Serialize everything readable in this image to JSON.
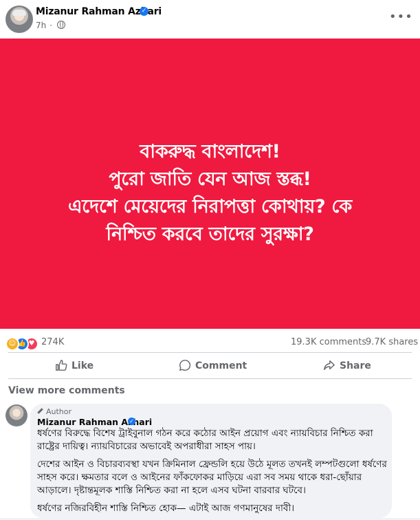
{
  "post": {
    "author": "Mizanur Rahman Azhari",
    "time": "7h",
    "separator": "·",
    "menu_label": "•••"
  },
  "poster": {
    "background": "#f0193f",
    "lines": [
      "বাকরুদ্ধ বাংলাদেশ!",
      "পুরো জাতি যেন আজ স্তব্ধ!",
      "এদেশে মেয়েদের নিরাপত্তা কোথায়? কে",
      "নিশ্চিত করবে তাদের সুরক্ষা?"
    ]
  },
  "stats": {
    "reactions": "274K",
    "comments": "19.3K comments",
    "shares": "9.7K shares",
    "reaction_icons": [
      "care-icon",
      "like-icon",
      "love-icon"
    ]
  },
  "actions": {
    "like": "Like",
    "comment": "Comment",
    "share": "Share"
  },
  "comments": {
    "view_more": "View more comments",
    "top": {
      "badge": "Author",
      "author": "Mizanur Rahman Azhari",
      "paragraphs": [
        "ধর্ষণের বিরুদ্ধে বিশেষ ট্রাইবুনাল গঠন করে কঠোর আইন প্রয়োগ এবং ন্যায়বিচার নিশ্চিত করা রাষ্ট্রের দায়িত্ব। ন্যায়বিচারের অভাবেই অপরাধীরা সাহস পায়।",
        "দেশের আইন ও বিচারব্যবস্থা যখন ক্রিমিনাল ফ্রেন্ডলি হয়ে উঠে মূলত তখনই লম্পটগুলো ধর্ষণের সাহস করে। ক্ষমতার বলে ও আইনের ফাঁকফোকর মাড়িয়ে এরা সব সময় থাকে ধরা-ছোঁয়ার আড়ালে। দৃষ্টান্তমূলক শাস্তি নিশ্চিত করা না হলে এসব ঘটনা বারবার ঘটবে।",
        "ধর্ষণের নজিরবিহীন শাস্তি নিশ্চিত হোক— এটাই আজ গণমানুষের দাবী।"
      ]
    }
  },
  "colors": {
    "accent": "#1877f2",
    "muted_text": "#65676b"
  }
}
